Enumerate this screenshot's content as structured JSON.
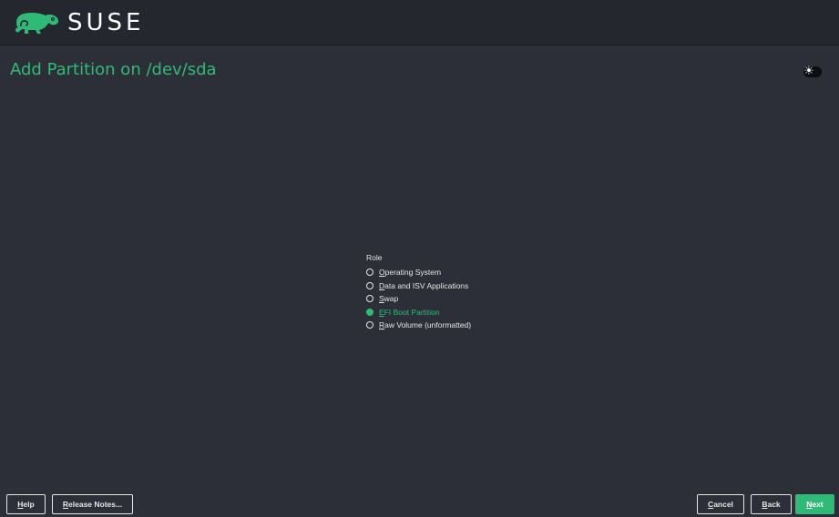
{
  "header": {
    "logo_text": "SUSE",
    "logo_icon": "chameleon-icon"
  },
  "page": {
    "title": "Add Partition on /dev/sda",
    "theme_toggle_icon": "sun-icon"
  },
  "role": {
    "label": "Role",
    "options": [
      {
        "mnemonic": "O",
        "rest": "perating System",
        "selected": false
      },
      {
        "mnemonic": "D",
        "rest": "ata and ISV Applications",
        "selected": false
      },
      {
        "mnemonic": "S",
        "rest": "wap",
        "selected": false
      },
      {
        "mnemonic": "E",
        "rest": "FI Boot Partition",
        "selected": true
      },
      {
        "mnemonic": "R",
        "rest": "aw Volume (unformatted)",
        "selected": false
      }
    ]
  },
  "buttons": {
    "help": {
      "mnemonic": "H",
      "rest": "elp"
    },
    "release_notes": {
      "mnemonic": "R",
      "rest": "elease Notes..."
    },
    "cancel": {
      "mnemonic": "C",
      "rest": "ancel"
    },
    "back": {
      "mnemonic": "B",
      "rest": "ack"
    },
    "next": {
      "mnemonic": "N",
      "rest": "ext"
    }
  },
  "colors": {
    "accent": "#30ba78",
    "background": "#2c2f38",
    "header": "#24272e"
  }
}
